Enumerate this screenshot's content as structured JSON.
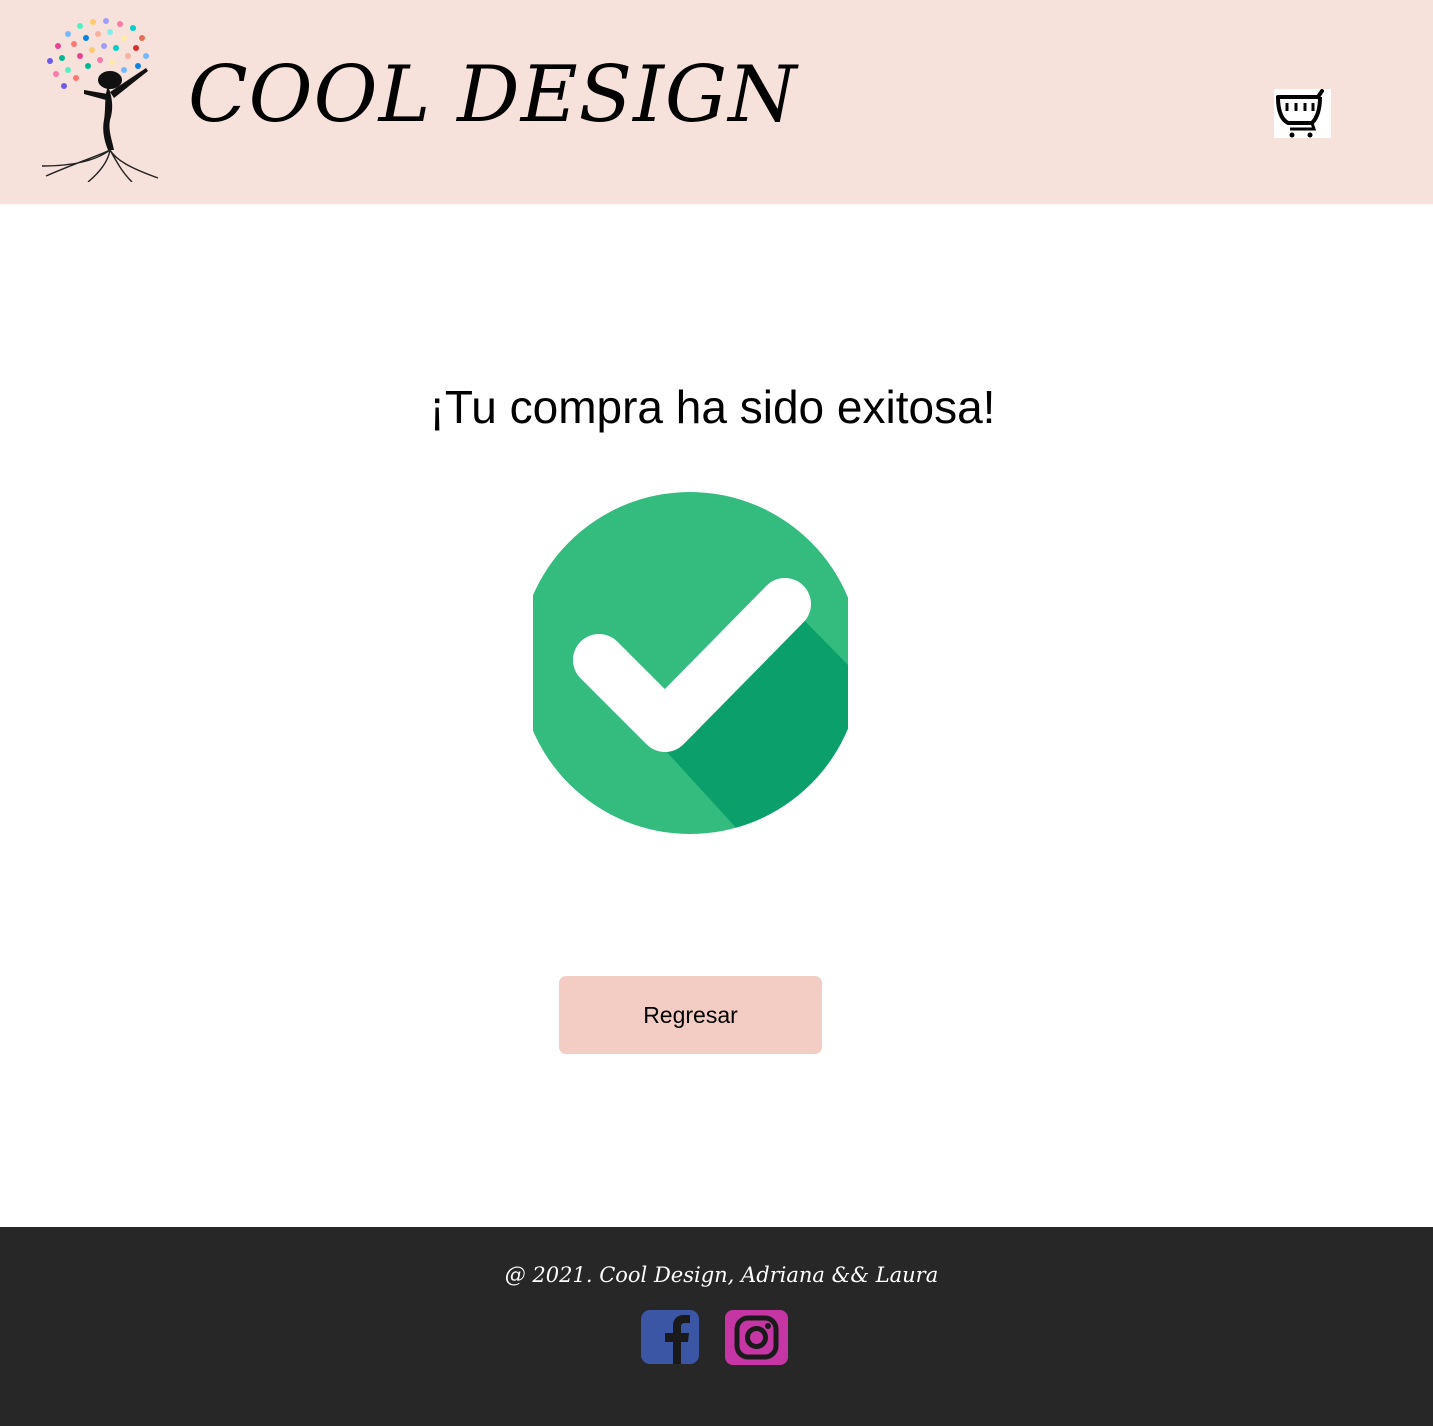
{
  "header": {
    "brand": "COOL DESIGN",
    "logo_icon": "tree-woman-butterflies-logo",
    "cart_icon": "shopping-cart-icon"
  },
  "main": {
    "title": "¡Tu compra ha sido exitosa!",
    "success_icon": "check-circle-icon",
    "button_label": "Regresar"
  },
  "footer": {
    "copyright": "@ 2021. Cool Design, Adriana && Laura",
    "social": [
      "facebook-icon",
      "instagram-icon"
    ]
  },
  "colors": {
    "header_bg": "#f7e1db",
    "button_bg": "#f3cdc3",
    "footer_bg": "#272727",
    "success_green": "#34bb7e",
    "success_green_dark": "#0b9f6b",
    "facebook": "#3b56a4",
    "instagram": "#c536a4"
  }
}
